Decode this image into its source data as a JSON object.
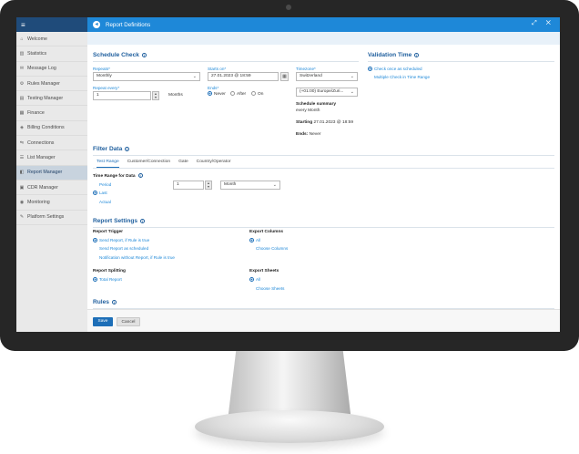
{
  "sidebar": {
    "menu_glyph": "≡",
    "items": [
      {
        "label": "Welcome",
        "icon": "home-icon",
        "glyph": "⌂"
      },
      {
        "label": "Statistics",
        "icon": "chart-icon",
        "glyph": "▥"
      },
      {
        "label": "Message Log",
        "icon": "message-icon",
        "glyph": "✉"
      },
      {
        "label": "Rules Manager",
        "icon": "rules-icon",
        "glyph": "⚙"
      },
      {
        "label": "Testing Manager",
        "icon": "test-icon",
        "glyph": "▤"
      },
      {
        "label": "Finance",
        "icon": "finance-icon",
        "glyph": "▦"
      },
      {
        "label": "Billing Conditions",
        "icon": "billing-icon",
        "glyph": "◈"
      },
      {
        "label": "Connections",
        "icon": "connections-icon",
        "glyph": "⇋"
      },
      {
        "label": "List Manager",
        "icon": "list-icon",
        "glyph": "☰"
      },
      {
        "label": "Report Manager",
        "icon": "report-icon",
        "glyph": "◧"
      },
      {
        "label": "CDR Manager",
        "icon": "cdr-icon",
        "glyph": "▣"
      },
      {
        "label": "Monitoring",
        "icon": "monitor-icon",
        "glyph": "◉"
      },
      {
        "label": "Platform Settings",
        "icon": "wrench-icon",
        "glyph": "✎"
      }
    ],
    "active_index": 9
  },
  "dialog": {
    "title": "Report Definitions",
    "back_glyph": "◂",
    "controls": "⤢ ✕"
  },
  "schedule": {
    "heading": "Schedule Check",
    "repeats_label": "Repeats*",
    "repeats_value": "Monthly",
    "repeat_every_label": "Repeat every*",
    "repeat_every_value": "1",
    "repeat_unit": "Months",
    "starts_on_label": "Starts on*",
    "starts_on_value": "27.01.2023 @ 18:59",
    "ends_label": "Ends*",
    "ends_options": [
      "Never",
      "After",
      "On"
    ],
    "timezone_label": "Timezone*",
    "timezone_value": "Switzerland",
    "timezone_offset": "(+01:00) Europe/Zuri...",
    "summary_label": "Schedule summary",
    "summary_value": "every Month",
    "starting_label": "Starting",
    "starting_value": "27.01.2023 @ 18:59",
    "ends_summary_label": "Ends:",
    "ends_summary_value": "Never"
  },
  "validation": {
    "heading": "Validation Time",
    "options": [
      "Check once as scheduled",
      "Multiple Check in Time Range"
    ]
  },
  "filter": {
    "heading": "Filter Data",
    "tabs": [
      "Test Range",
      "Customer/Connection",
      "Gate",
      "Country/Operator"
    ],
    "time_range_label": "Time Range for Data",
    "period_options": [
      "Period",
      "Last",
      "Actual"
    ],
    "last_value": "1",
    "unit_value": "Month"
  },
  "report_settings": {
    "heading": "Report Settings",
    "trigger_label": "Report Trigger",
    "trigger_options": [
      "Send Report, if Rule is true",
      "Send Report as scheduled",
      "Notification without Report, if Rule is true"
    ],
    "export_columns_label": "Export Columns",
    "export_columns_options": [
      "All",
      "Choose Columns"
    ],
    "splitting_label": "Report Splitting",
    "splitting_option": "Total Report",
    "export_sheets_label": "Export Sheets",
    "export_sheets_options": [
      "All",
      "Choose Sheets"
    ]
  },
  "rules": {
    "heading": "Rules"
  },
  "footer": {
    "save_label": "Save",
    "cancel_label": "Cancel"
  },
  "glyphs": {
    "info": "i",
    "dropdown": "⌄",
    "spin_up": "▲",
    "spin_down": "▼",
    "calendar": "▦"
  }
}
